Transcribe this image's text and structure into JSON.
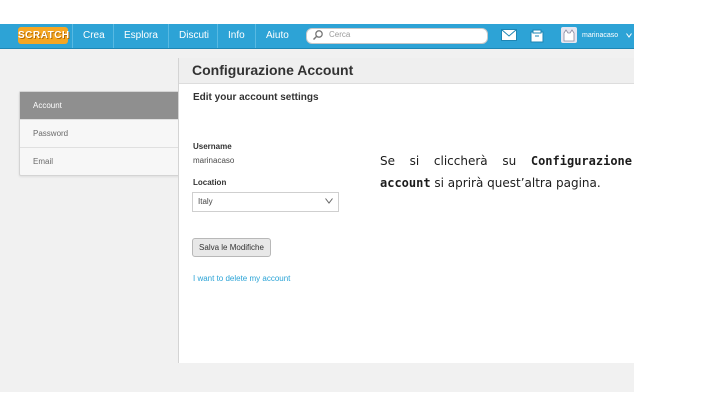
{
  "topbar": {
    "logo_text": "SCRATCH",
    "nav": [
      "Crea",
      "Esplora",
      "Discuti",
      "Info",
      "Aiuto"
    ],
    "search_placeholder": "Cerca",
    "username": "marinacaso",
    "icons": [
      "messages-icon",
      "my-stuff-icon",
      "avatar",
      "chevron-down-icon"
    ],
    "colors": {
      "bar": "#2da3d6",
      "logo": "#f5a623"
    }
  },
  "sidebar": {
    "items": [
      {
        "label": "Account",
        "active": true
      },
      {
        "label": "Password",
        "active": false
      },
      {
        "label": "Email",
        "active": false
      }
    ]
  },
  "main": {
    "title": "Configurazione Account",
    "section_title": "Edit your account settings",
    "username_label": "Username",
    "username_value": "marinacaso",
    "location_label": "Location",
    "location_value": "Italy",
    "save_label": "Salva le Modifiche",
    "delete_link": "I want to delete my account"
  },
  "annotation": {
    "part1": "Se si cliccherà su ",
    "bold1": "Configurazione account",
    "part2": " si aprirà quest’altra pagina."
  }
}
